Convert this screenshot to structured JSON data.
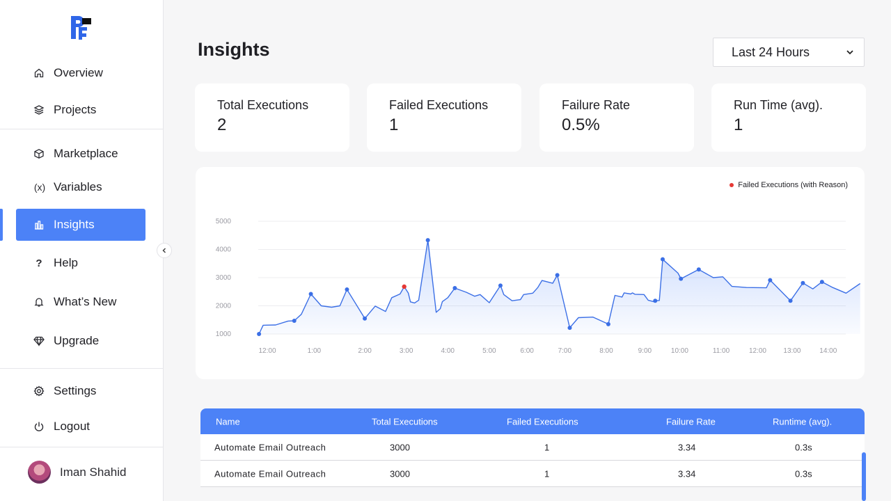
{
  "sidebar": {
    "items": [
      {
        "label": "Overview",
        "icon": "home-icon"
      },
      {
        "label": "Projects",
        "icon": "layers-icon"
      },
      {
        "label": "Marketplace",
        "icon": "box-icon"
      },
      {
        "label": "Variables",
        "icon": "variable-icon"
      },
      {
        "label": "Insights",
        "icon": "bar-chart-icon",
        "active": true
      },
      {
        "label": "Help",
        "icon": "question-icon"
      },
      {
        "label": "What’s New",
        "icon": "bell-icon"
      },
      {
        "label": "Upgrade",
        "icon": "diamond-icon"
      },
      {
        "label": "Settings",
        "icon": "gear-icon"
      },
      {
        "label": "Logout",
        "icon": "power-icon"
      }
    ],
    "variables_glyph": "(x)",
    "help_glyph": "?",
    "user": {
      "name": "Iman Shahid"
    }
  },
  "header": {
    "title": "Insights",
    "range_select": {
      "value": "Last 24 Hours"
    }
  },
  "stats": [
    {
      "label": "Total Executions",
      "value": "2"
    },
    {
      "label": "Failed Executions",
      "value": "1"
    },
    {
      "label": "Failure Rate",
      "value": "0.5%"
    },
    {
      "label": "Run Time (avg).",
      "value": "1"
    }
  ],
  "chart_data": {
    "type": "area",
    "legend": [
      "Failed Executions (with Reason)"
    ],
    "ylim": [
      1000,
      5000
    ],
    "y_ticks": [
      "5000",
      "4000",
      "3000",
      "2000",
      "1000"
    ],
    "x_ticks": [
      "12:00",
      "1:00",
      "2:00",
      "3:00",
      "4:00",
      "5:00",
      "6:00",
      "7:00",
      "8:00",
      "9:00",
      "10:00",
      "11:00",
      "12:00",
      "13:00",
      "14:00"
    ],
    "x_tick_pos": [
      0.0,
      1.13,
      2.35,
      3.35,
      4.35,
      5.35,
      6.26,
      7.17,
      8.17,
      9.1,
      9.94,
      10.94,
      11.82,
      12.65,
      13.52
    ],
    "series": [
      {
        "values": [
          [
            -0.2,
            1000
          ],
          [
            -0.1,
            1310
          ],
          [
            0.2,
            1320
          ],
          [
            0.5,
            1460
          ],
          [
            0.65,
            1470
          ],
          [
            0.82,
            1700
          ],
          [
            1.05,
            2420
          ],
          [
            1.3,
            2000
          ],
          [
            1.55,
            1950
          ],
          [
            1.75,
            2000
          ],
          [
            1.92,
            2580
          ],
          [
            2.35,
            1550
          ],
          [
            2.6,
            1990
          ],
          [
            2.85,
            1800
          ],
          [
            3.0,
            2290
          ],
          [
            3.2,
            2420
          ],
          [
            3.3,
            2680
          ],
          [
            3.4,
            2450
          ],
          [
            3.45,
            2140
          ],
          [
            3.55,
            2100
          ],
          [
            3.65,
            2200
          ],
          [
            3.87,
            4330
          ],
          [
            4.07,
            1770
          ],
          [
            4.17,
            1900
          ],
          [
            4.22,
            2150
          ],
          [
            4.35,
            2290
          ],
          [
            4.52,
            2630
          ],
          [
            4.8,
            2480
          ],
          [
            5.0,
            2340
          ],
          [
            5.13,
            2400
          ],
          [
            5.35,
            2110
          ],
          [
            5.62,
            2720
          ],
          [
            5.7,
            2400
          ],
          [
            5.9,
            2180
          ],
          [
            6.1,
            2220
          ],
          [
            6.18,
            2400
          ],
          [
            6.4,
            2450
          ],
          [
            6.52,
            2650
          ],
          [
            6.62,
            2900
          ],
          [
            6.88,
            2800
          ],
          [
            6.99,
            3090
          ],
          [
            7.29,
            1220
          ],
          [
            7.5,
            1580
          ],
          [
            7.85,
            1600
          ],
          [
            8.22,
            1350
          ],
          [
            8.38,
            2370
          ],
          [
            8.55,
            2310
          ],
          [
            8.6,
            2460
          ],
          [
            8.76,
            2420
          ],
          [
            8.8,
            2460
          ],
          [
            8.86,
            2410
          ],
          [
            9.08,
            2400
          ],
          [
            9.18,
            2200
          ],
          [
            9.33,
            2140
          ],
          [
            9.35,
            2180
          ],
          [
            9.45,
            2190
          ],
          [
            9.53,
            3650
          ],
          [
            9.9,
            3160
          ],
          [
            9.97,
            2960
          ],
          [
            10.4,
            3290
          ],
          [
            10.75,
            3000
          ],
          [
            10.98,
            3030
          ],
          [
            11.2,
            2690
          ],
          [
            11.55,
            2650
          ],
          [
            12.03,
            2640
          ],
          [
            12.12,
            2910
          ],
          [
            12.61,
            2180
          ],
          [
            12.91,
            2810
          ],
          [
            13.15,
            2600
          ],
          [
            13.37,
            2850
          ],
          [
            13.63,
            2650
          ],
          [
            13.95,
            2450
          ],
          [
            14.29,
            2790
          ]
        ],
        "markers": [
          [
            -0.2,
            1000
          ],
          [
            0.65,
            1470
          ],
          [
            1.05,
            2420
          ],
          [
            1.92,
            2580
          ],
          [
            2.35,
            1550
          ],
          [
            4.52,
            2630
          ],
          [
            5.62,
            2720
          ],
          [
            6.99,
            3090
          ],
          [
            7.29,
            1220
          ],
          [
            8.22,
            1350
          ],
          [
            9.53,
            3650
          ],
          [
            10.4,
            3290
          ],
          [
            12.12,
            2910
          ],
          [
            12.61,
            2180
          ],
          [
            13.37,
            2850
          ],
          [
            9.35,
            2180
          ],
          [
            9.97,
            2960
          ],
          [
            12.91,
            2810
          ]
        ],
        "failed_markers": [
          [
            3.3,
            2680
          ]
        ],
        "peak_marker": [
          3.87,
          4330
        ],
        "color": "#3b6fe6"
      }
    ]
  },
  "table": {
    "columns": [
      "Name",
      "Total Executions",
      "Failed Executions",
      "Failure Rate",
      "Runtime (avg)."
    ],
    "rows": [
      [
        "Automate Email Outreach",
        "3000",
        "1",
        "3.34",
        "0.3s"
      ],
      [
        "Automate Email Outreach",
        "3000",
        "1",
        "3.34",
        "0.3s"
      ]
    ]
  },
  "colors": {
    "accent": "#4c82f7",
    "failed": "#e53935"
  }
}
